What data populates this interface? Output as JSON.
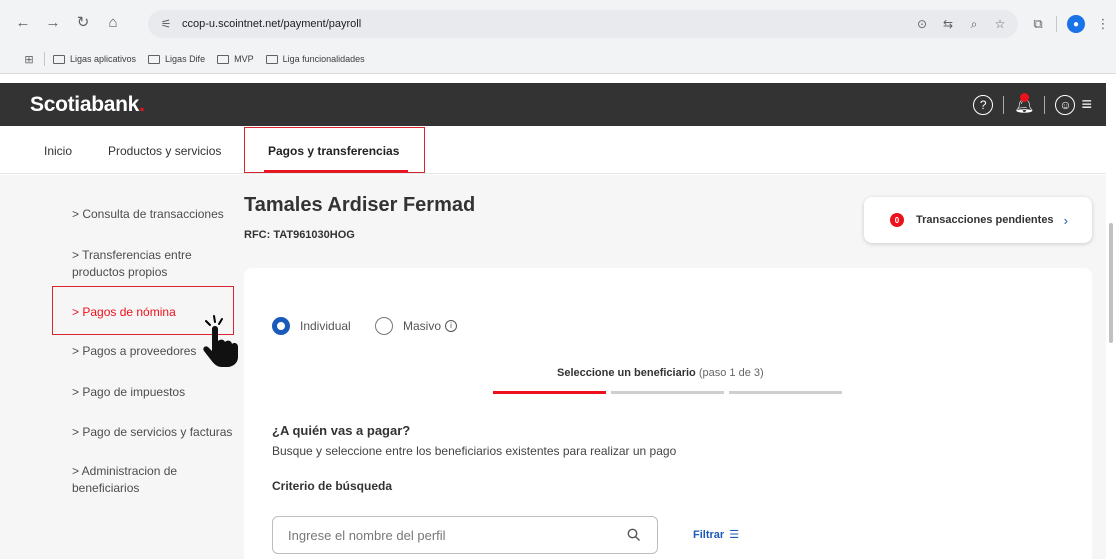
{
  "browser": {
    "url": "ccop-u.scointnet.net/payment/payroll",
    "bookmarks": [
      "Ligas aplicativos",
      "Ligas Dife",
      "MVP",
      "Liga funcionalidades"
    ]
  },
  "header": {
    "logo": "Scotiabank",
    "logo_dot": ".",
    "help_icon_text": "?",
    "profile_icon_text": "☺"
  },
  "tabs": [
    {
      "label": "Inicio"
    },
    {
      "label": "Productos y servicios"
    },
    {
      "label": "Pagos y transferencias",
      "active": true
    }
  ],
  "sidebar": {
    "items": [
      {
        "label": "> Consulta de transacciones"
      },
      {
        "label": "> Transferencias entre productos propios"
      },
      {
        "label": "> Pagos de nómina",
        "active": true
      },
      {
        "label": "> Pagos a proveedores"
      },
      {
        "label": "> Pago de impuestos"
      },
      {
        "label": "> Pago de servicios y facturas"
      },
      {
        "label": "> Administracion de beneficiarios"
      }
    ]
  },
  "main": {
    "title": "Tamales Ardiser Fermad",
    "rfc": "RFC: TAT961030HOG",
    "pending": {
      "count": "0",
      "label": "Transacciones pendientes"
    },
    "payment_type": {
      "options": [
        {
          "label": "Individual",
          "selected": true
        },
        {
          "label": "Masivo",
          "selected": false
        }
      ]
    },
    "step": {
      "label": "Seleccione un beneficiario",
      "sub": "(paso 1 de 3)",
      "current": 1,
      "total": 3
    },
    "question": "¿A quién vas a pagar?",
    "description": "Busque y seleccione entre los beneficiarios existentes para realizar un pago",
    "criteria_label": "Criterio de búsqueda",
    "search": {
      "placeholder": "Ingrese el nombre del perfil"
    },
    "filter_label": "Filtrar"
  },
  "colors": {
    "brand_red": "#ec111a",
    "header_bg": "#333333",
    "link_blue": "#1a5ab8"
  }
}
